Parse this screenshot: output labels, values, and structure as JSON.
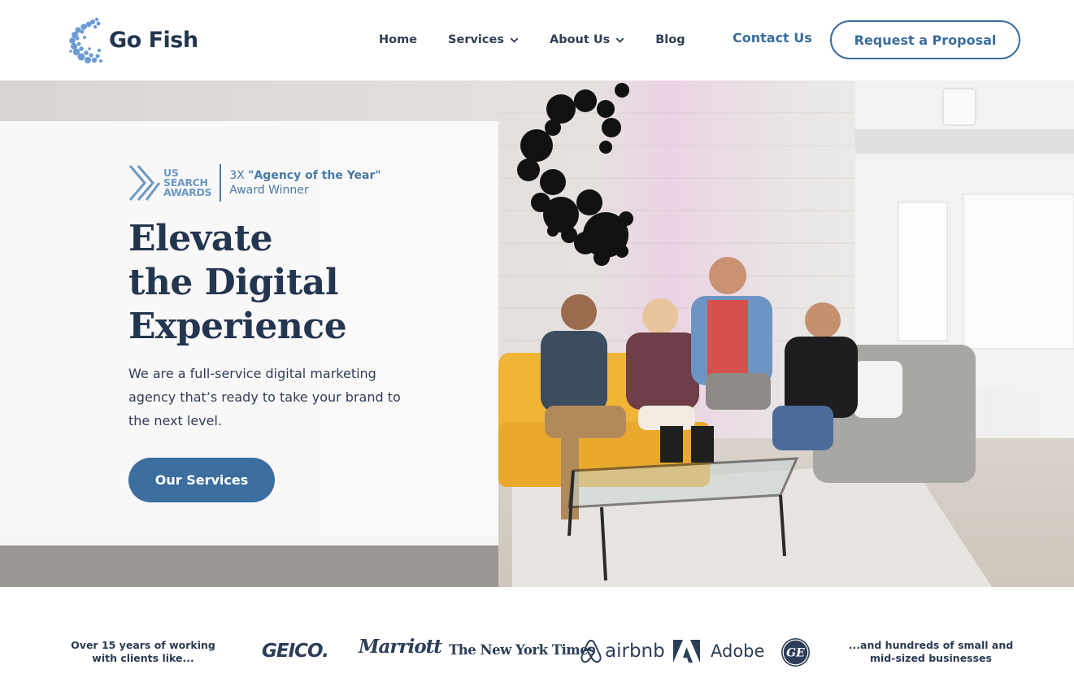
{
  "header": {
    "logo_text": "Go Fish",
    "nav": {
      "home": "Home",
      "services": "Services",
      "about": "About Us",
      "blog": "Blog"
    },
    "contact": "Contact Us",
    "cta": "Request a Proposal"
  },
  "hero": {
    "award": {
      "logo_lines": [
        "US",
        "SEARCH",
        "AWARDS"
      ],
      "prefix": "3X ",
      "title": "\"Agency of the Year\"",
      "subtitle": "Award Winner"
    },
    "title_lines": [
      "Elevate",
      "the Digital",
      "Experience"
    ],
    "description": "We are a full-service digital marketing agency that’s ready to take your brand to the next level.",
    "button": "Our Services"
  },
  "clients": {
    "lead_lines": [
      "Over 15 years of working",
      "with clients like..."
    ],
    "brands": {
      "geico": "GEICO.",
      "marriott": "Marriott",
      "nyt": "The New York Times",
      "airbnb": "airbnb",
      "adobe": "Adobe"
    },
    "tail_lines": [
      "...and hundreds of small and",
      "mid-sized businesses"
    ]
  },
  "colors": {
    "navy": "#24364f",
    "accent_blue": "#3c6e9f",
    "logo_blue": "#6d98c4"
  },
  "icons": {
    "logo": "go-fish-bubble-logo",
    "nav_dropdown": "chevron-down-icon",
    "award": "us-search-awards-chevrons",
    "airbnb": "airbnb-belo-icon",
    "adobe": "adobe-a-icon",
    "ge": "ge-monogram-icon"
  }
}
